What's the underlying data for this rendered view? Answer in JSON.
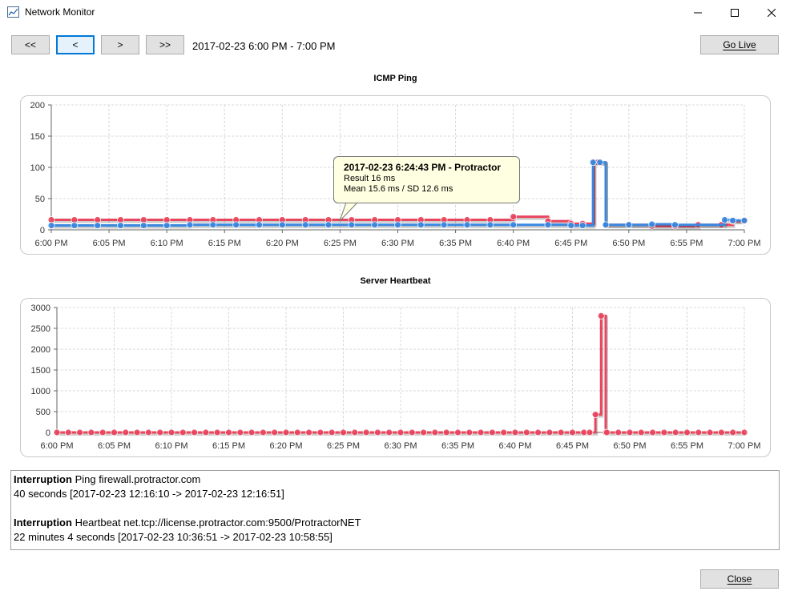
{
  "window": {
    "title": "Network Monitor",
    "min": "—",
    "max": "☐",
    "close": "✕"
  },
  "nav": {
    "first": "<<",
    "prev": "<",
    "next": ">",
    "last": ">>",
    "range": "2017-02-23 6:00 PM - 7:00 PM",
    "go_live": "Go Live"
  },
  "colors": {
    "red": "#e8455e",
    "blue": "#3a87e0",
    "grid": "#d8d8d8"
  },
  "chart_data": [
    {
      "type": "line",
      "title": "ICMP Ping",
      "x_ticks": [
        "6:00 PM",
        "6:05 PM",
        "6:10 PM",
        "6:15 PM",
        "6:20 PM",
        "6:25 PM",
        "6:30 PM",
        "6:35 PM",
        "6:40 PM",
        "6:45 PM",
        "6:50 PM",
        "6:55 PM",
        "7:00 PM"
      ],
      "ylim": [
        0,
        200
      ],
      "y_ticks": [
        0,
        50,
        100,
        150,
        200
      ],
      "grid": true,
      "series": [
        {
          "color": "red",
          "step": true,
          "points": [
            [
              0,
              16
            ],
            [
              2,
              16
            ],
            [
              4,
              16
            ],
            [
              6,
              16
            ],
            [
              8,
              16
            ],
            [
              10,
              16
            ],
            [
              12,
              16
            ],
            [
              14,
              16
            ],
            [
              16,
              16
            ],
            [
              18,
              16
            ],
            [
              20,
              16
            ],
            [
              22,
              16
            ],
            [
              24,
              16
            ],
            [
              26,
              16
            ],
            [
              28,
              16
            ],
            [
              30,
              16
            ],
            [
              32,
              16
            ],
            [
              34,
              16
            ],
            [
              36,
              16
            ],
            [
              38,
              16
            ],
            [
              40,
              21
            ],
            [
              43,
              14
            ],
            [
              45,
              10
            ],
            [
              46,
              10
            ],
            [
              47,
              108
            ],
            [
              47.3,
              108
            ],
            [
              48,
              8
            ],
            [
              50,
              8
            ],
            [
              52,
              6
            ],
            [
              54,
              6
            ],
            [
              56,
              8
            ],
            [
              58,
              8
            ],
            [
              59,
              14
            ],
            [
              60,
              14
            ]
          ]
        },
        {
          "color": "blue",
          "step": true,
          "points": [
            [
              0,
              7
            ],
            [
              2,
              7
            ],
            [
              4,
              7
            ],
            [
              6,
              7
            ],
            [
              8,
              7
            ],
            [
              10,
              7
            ],
            [
              12,
              8
            ],
            [
              14,
              8
            ],
            [
              16,
              8
            ],
            [
              18,
              8
            ],
            [
              20,
              8
            ],
            [
              22,
              8
            ],
            [
              24,
              8
            ],
            [
              26,
              8
            ],
            [
              28,
              8
            ],
            [
              30,
              8
            ],
            [
              32,
              8
            ],
            [
              34,
              8
            ],
            [
              36,
              8
            ],
            [
              38,
              8
            ],
            [
              40,
              8
            ],
            [
              43,
              8
            ],
            [
              45,
              7
            ],
            [
              46,
              7
            ],
            [
              46.9,
              108
            ],
            [
              47.5,
              108
            ],
            [
              48,
              8
            ],
            [
              50,
              8
            ],
            [
              52,
              9
            ],
            [
              54,
              8
            ],
            [
              58.3,
              16
            ],
            [
              59,
              15
            ],
            [
              60,
              15
            ]
          ]
        }
      ]
    },
    {
      "type": "line",
      "title": "Server Heartbeat",
      "x_ticks": [
        "6:00 PM",
        "6:05 PM",
        "6:10 PM",
        "6:15 PM",
        "6:20 PM",
        "6:25 PM",
        "6:30 PM",
        "6:35 PM",
        "6:40 PM",
        "6:45 PM",
        "6:50 PM",
        "6:55 PM",
        "7:00 PM"
      ],
      "ylim": [
        0,
        3000
      ],
      "y_ticks": [
        0,
        500,
        1000,
        1500,
        2000,
        2500,
        3000
      ],
      "grid": true,
      "series": [
        {
          "color": "red",
          "step": true,
          "points": [
            [
              0,
              0
            ],
            [
              1,
              0
            ],
            [
              2,
              0
            ],
            [
              3,
              0
            ],
            [
              4,
              0
            ],
            [
              5,
              0
            ],
            [
              6,
              0
            ],
            [
              7,
              0
            ],
            [
              8,
              0
            ],
            [
              9,
              0
            ],
            [
              10,
              0
            ],
            [
              11,
              0
            ],
            [
              12,
              0
            ],
            [
              13,
              0
            ],
            [
              14,
              0
            ],
            [
              15,
              0
            ],
            [
              16,
              0
            ],
            [
              17,
              0
            ],
            [
              18,
              0
            ],
            [
              19,
              0
            ],
            [
              20,
              0
            ],
            [
              21,
              0
            ],
            [
              22,
              0
            ],
            [
              23,
              0
            ],
            [
              24,
              0
            ],
            [
              25,
              0
            ],
            [
              26,
              0
            ],
            [
              27,
              0
            ],
            [
              28,
              0
            ],
            [
              29,
              0
            ],
            [
              30,
              0
            ],
            [
              31,
              0
            ],
            [
              32,
              0
            ],
            [
              33,
              0
            ],
            [
              34,
              0
            ],
            [
              35,
              0
            ],
            [
              36,
              0
            ],
            [
              37,
              0
            ],
            [
              38,
              0
            ],
            [
              39,
              0
            ],
            [
              40,
              0
            ],
            [
              41,
              0
            ],
            [
              42,
              0
            ],
            [
              43,
              0
            ],
            [
              44,
              0
            ],
            [
              45,
              0
            ],
            [
              46,
              0
            ],
            [
              46.5,
              0
            ],
            [
              47,
              430
            ],
            [
              47.5,
              2800
            ],
            [
              47.9,
              0
            ],
            [
              48,
              0
            ],
            [
              49,
              0
            ],
            [
              50,
              0
            ],
            [
              51,
              0
            ],
            [
              52,
              0
            ],
            [
              53,
              0
            ],
            [
              54,
              0
            ],
            [
              55,
              0
            ],
            [
              56,
              0
            ],
            [
              57,
              0
            ],
            [
              58,
              0
            ],
            [
              59,
              0
            ],
            [
              60,
              0
            ]
          ]
        }
      ]
    }
  ],
  "tooltip": {
    "title": "2017-02-23 6:24:43 PM - Protractor",
    "line1": "Result 16 ms",
    "line2": "Mean 15.6 ms / SD 12.6 ms"
  },
  "log": [
    {
      "kind": "Interruption",
      "target": "Ping firewall.protractor.com",
      "detail": "40 seconds [2017-02-23 12:16:10 -> 2017-02-23 12:16:51]"
    },
    {
      "kind": "Interruption",
      "target": "Heartbeat net.tcp://license.protractor.com:9500/ProtractorNET",
      "detail": "22 minutes 4 seconds [2017-02-23 10:36:51 -> 2017-02-23 10:58:55]"
    }
  ],
  "footer": {
    "close": "Close"
  }
}
